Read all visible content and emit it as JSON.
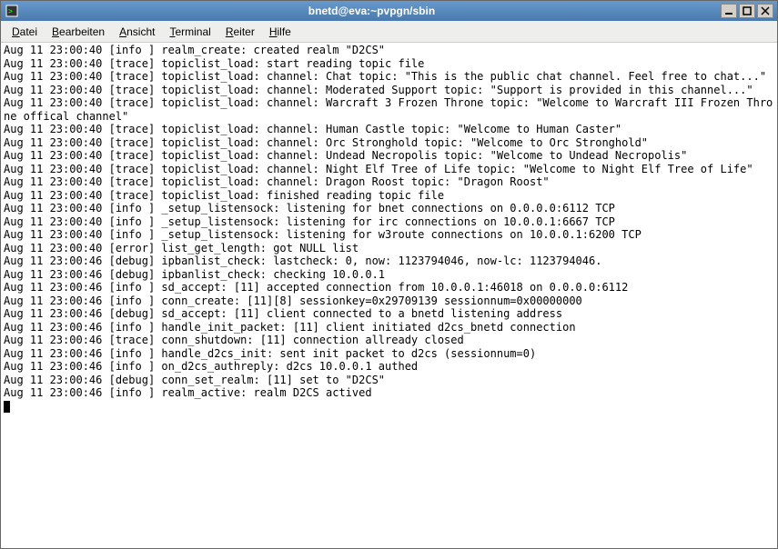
{
  "window": {
    "title": "bnetd@eva:~pvpgn/sbin"
  },
  "menu": {
    "items": [
      {
        "label": "Datei",
        "accel": "D"
      },
      {
        "label": "Bearbeiten",
        "accel": "B"
      },
      {
        "label": "Ansicht",
        "accel": "A"
      },
      {
        "label": "Terminal",
        "accel": "T"
      },
      {
        "label": "Reiter",
        "accel": "R"
      },
      {
        "label": "Hilfe",
        "accel": "H"
      }
    ]
  },
  "terminal": {
    "lines": [
      "Aug 11 23:00:40 [info ] realm_create: created realm \"D2CS\"",
      "Aug 11 23:00:40 [trace] topiclist_load: start reading topic file",
      "Aug 11 23:00:40 [trace] topiclist_load: channel: Chat topic: \"This is the public chat channel. Feel free to chat...\"",
      "Aug 11 23:00:40 [trace] topiclist_load: channel: Moderated Support topic: \"Support is provided in this channel...\"",
      "Aug 11 23:00:40 [trace] topiclist_load: channel: Warcraft 3 Frozen Throne topic: \"Welcome to Warcraft III Frozen Throne offical channel\"",
      "Aug 11 23:00:40 [trace] topiclist_load: channel: Human Castle topic: \"Welcome to Human Caster\"",
      "Aug 11 23:00:40 [trace] topiclist_load: channel: Orc Stronghold topic: \"Welcome to Orc Stronghold\"",
      "Aug 11 23:00:40 [trace] topiclist_load: channel: Undead Necropolis topic: \"Welcome to Undead Necropolis\"",
      "Aug 11 23:00:40 [trace] topiclist_load: channel: Night Elf Tree of Life topic: \"Welcome to Night Elf Tree of Life\"",
      "Aug 11 23:00:40 [trace] topiclist_load: channel: Dragon Roost topic: \"Dragon Roost\"",
      "Aug 11 23:00:40 [trace] topiclist_load: finished reading topic file",
      "Aug 11 23:00:40 [info ] _setup_listensock: listening for bnet connections on 0.0.0.0:6112 TCP",
      "Aug 11 23:00:40 [info ] _setup_listensock: listening for irc connections on 10.0.0.1:6667 TCP",
      "Aug 11 23:00:40 [info ] _setup_listensock: listening for w3route connections on 10.0.0.1:6200 TCP",
      "Aug 11 23:00:40 [error] list_get_length: got NULL list",
      "Aug 11 23:00:46 [debug] ipbanlist_check: lastcheck: 0, now: 1123794046, now-lc: 1123794046.",
      "Aug 11 23:00:46 [debug] ipbanlist_check: checking 10.0.0.1",
      "Aug 11 23:00:46 [info ] sd_accept: [11] accepted connection from 10.0.0.1:46018 on 0.0.0.0:6112",
      "Aug 11 23:00:46 [info ] conn_create: [11][8] sessionkey=0x29709139 sessionnum=0x00000000",
      "Aug 11 23:00:46 [debug] sd_accept: [11] client connected to a bnetd listening address",
      "Aug 11 23:00:46 [info ] handle_init_packet: [11] client initiated d2cs_bnetd connection",
      "Aug 11 23:00:46 [trace] conn_shutdown: [11] connection allready closed",
      "Aug 11 23:00:46 [info ] handle_d2cs_init: sent init packet to d2cs (sessionnum=0)",
      "Aug 11 23:00:46 [info ] on_d2cs_authreply: d2cs 10.0.0.1 authed",
      "Aug 11 23:00:46 [debug] conn_set_realm: [11] set to \"D2CS\"",
      "Aug 11 23:00:46 [info ] realm_active: realm D2CS actived"
    ]
  }
}
